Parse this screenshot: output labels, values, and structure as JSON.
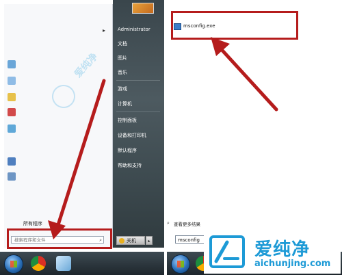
{
  "left_menu": {
    "user_name": "Administrator",
    "right_items": [
      "文档",
      "图片",
      "音乐",
      "游戏",
      "计算机",
      "控制面板",
      "设备和打印机",
      "默认程序",
      "帮助和支持"
    ],
    "all_programs_label": "所有程序",
    "search_placeholder": "搜索程序和文件",
    "shutdown_label": "关机",
    "shutdown_arrow": "▸",
    "chevron": "▸"
  },
  "right_menu": {
    "result_item": "msconfig.exe",
    "see_more_label": "查看更多结果",
    "search_value": "msconfig"
  },
  "watermark": {
    "brand": "爱纯净",
    "url": "aichunjing.com"
  },
  "colors": {
    "highlight_red": "#b51c1c",
    "brand_blue": "#1d9ad6"
  }
}
